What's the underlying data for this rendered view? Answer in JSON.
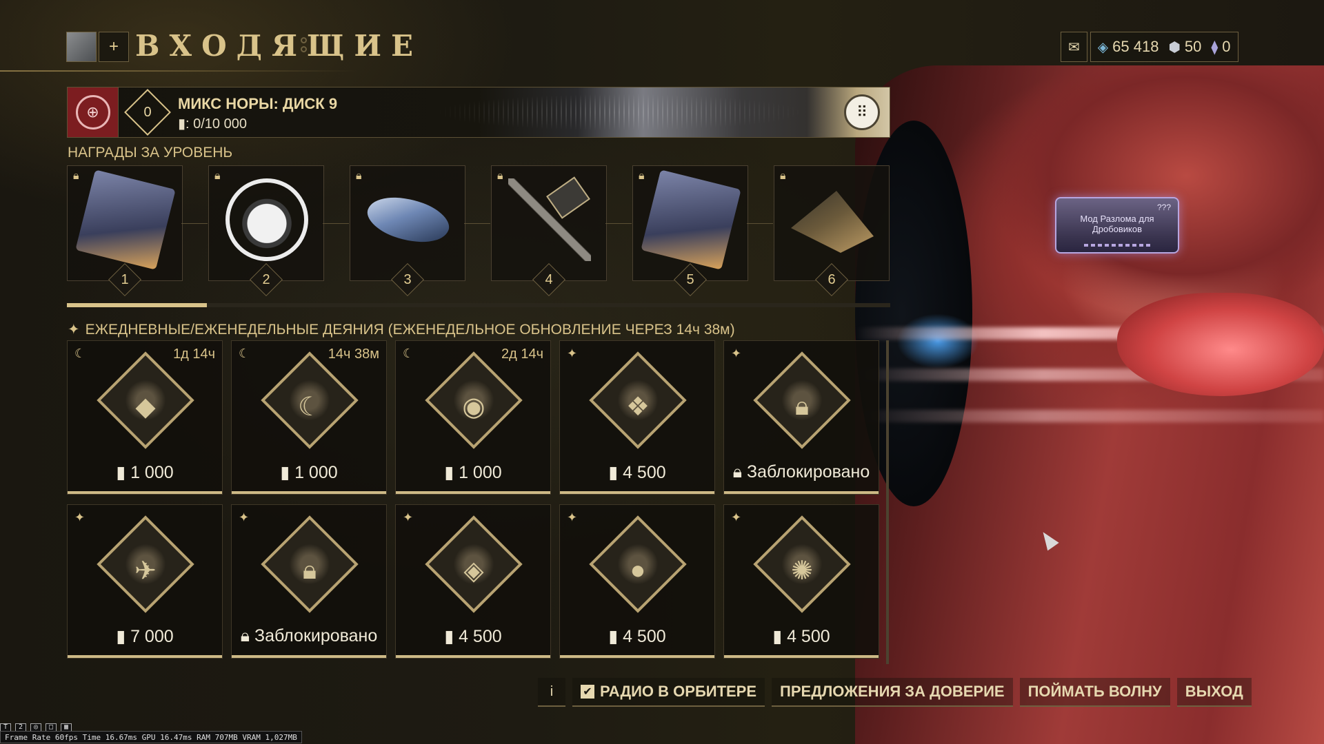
{
  "header": {
    "title": "ВХОДЯЩИЕ",
    "plus": "+",
    "currencies": {
      "mail_icon": "envelope-icon",
      "credits": "65 418",
      "platinum": "50",
      "aya": "0"
    }
  },
  "season": {
    "name": "МИКС НОРЫ: ДИСК 9",
    "rank": "0",
    "progress": ": 0/10 000"
  },
  "rank_rewards": {
    "label": "НАГРАДЫ ЗА УРОВЕНЬ",
    "progress_fraction": 0.17,
    "items": [
      {
        "rank": "1",
        "locked": true,
        "art": "card"
      },
      {
        "rank": "2",
        "locked": true,
        "art": "sigil"
      },
      {
        "rank": "3",
        "locked": true,
        "art": "pod"
      },
      {
        "rank": "4",
        "locked": true,
        "art": "hammer"
      },
      {
        "rank": "5",
        "locked": true,
        "art": "card"
      },
      {
        "rank": "6",
        "locked": true,
        "art": "ship"
      }
    ]
  },
  "acts": {
    "label": "ЕЖЕДНЕВНЫЕ/ЕЖЕНЕДЕЛЬНЫЕ ДЕЯНИЯ (ЕЖЕНЕДЕЛЬНОЕ ОБНОВЛЕНИЕ ЧЕРЕЗ 14ч 38м)",
    "items": [
      {
        "type": "daily",
        "timer": "1д 14ч",
        "reward": "1 000",
        "locked": false
      },
      {
        "type": "daily",
        "timer": "14ч 38м",
        "reward": "1 000",
        "locked": false
      },
      {
        "type": "daily",
        "timer": "2д 14ч",
        "reward": "1 000",
        "locked": false
      },
      {
        "type": "weekly",
        "timer": "",
        "reward": "4 500",
        "locked": false
      },
      {
        "type": "weekly",
        "timer": "",
        "reward": "Заблокировано",
        "locked": true
      },
      {
        "type": "weekly",
        "timer": "",
        "reward": "7 000",
        "locked": false
      },
      {
        "type": "weekly",
        "timer": "",
        "reward": "Заблокировано",
        "locked": true
      },
      {
        "type": "weekly",
        "timer": "",
        "reward": "4 500",
        "locked": false
      },
      {
        "type": "weekly",
        "timer": "",
        "reward": "4 500",
        "locked": false
      },
      {
        "type": "weekly",
        "timer": "",
        "reward": "4 500",
        "locked": false
      }
    ]
  },
  "mod_card": {
    "title": "Мод Разлома для Дробовиков",
    "badge": "???"
  },
  "bottom": {
    "info": "i",
    "radio": "РАДИО В ОРБИТЕРЕ",
    "radio_checked": true,
    "offers": "ПРЕДЛОЖЕНИЯ ЗА ДОВЕРИЕ",
    "catch": "ПОЙМАТЬ ВОЛНУ",
    "exit": "ВЫХОД"
  },
  "perf": {
    "text": "Frame Rate 60fps Time 16.67ms GPU 16.47ms RAM 707MB VRAM 1,027MB"
  },
  "colors": {
    "gold": "#d9c38a",
    "accent_red": "#7c1d20",
    "panel": "#14110b"
  }
}
